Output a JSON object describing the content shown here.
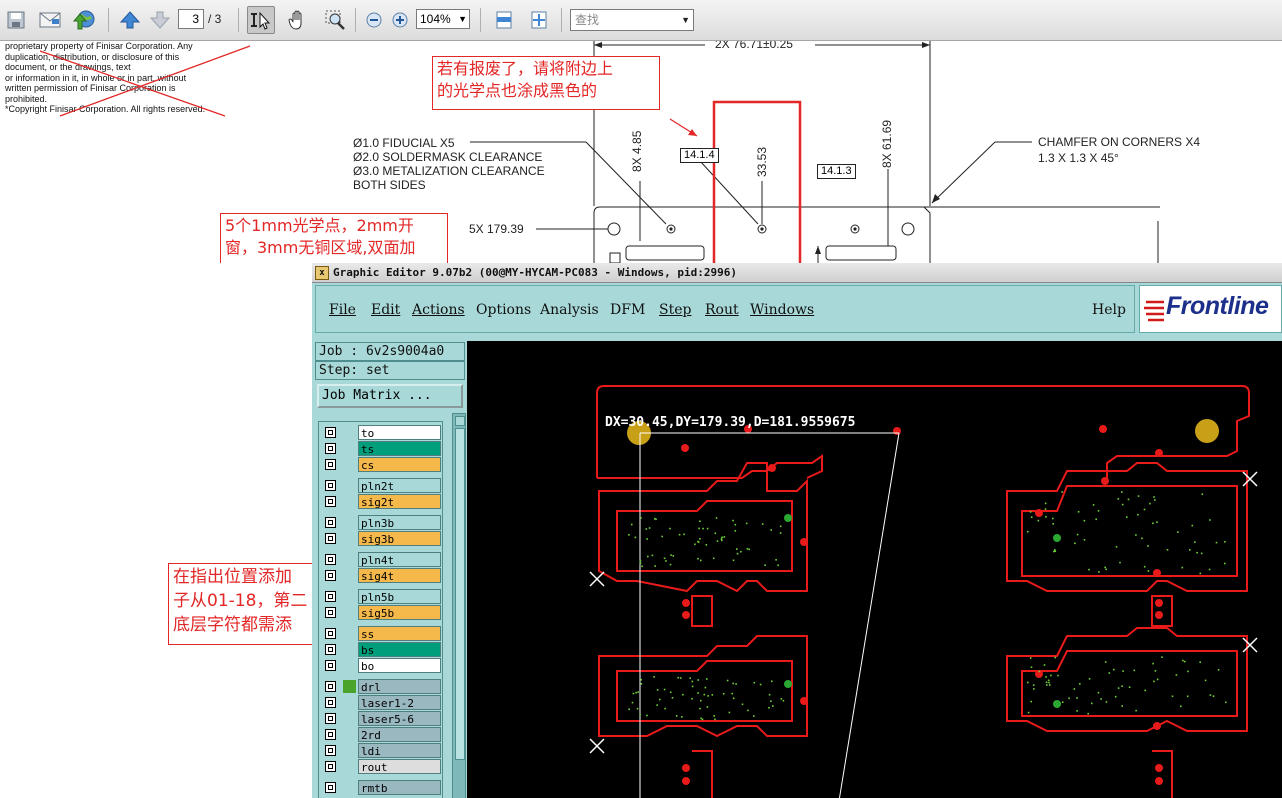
{
  "toolbar": {
    "page_current": "3",
    "page_total": "/ 3",
    "zoom": "104%",
    "search_placeholder": "查找"
  },
  "doc": {
    "legal_lines": [
      "proprietary property of Finisar Corporation. Any",
      "duplication, distribution, or disclosure of this",
      "document, or the drawings, text",
      "or information in it, in whole or in part, without",
      "written permission of Finisar Corporation is",
      "prohibited.",
      "*Copyright Finisar Corporation. All rights reserved."
    ],
    "dim_top": "2X 76.71±0.25",
    "fiducial_notes": [
      "Ø1.0 FIDUCIAL X5",
      "Ø2.0 SOLDERMASK CLEARANCE",
      "Ø3.0 METALIZATION CLEARANCE",
      "BOTH SIDES"
    ],
    "dim_fid_count": "5X 179.39",
    "dim_vert_a": "8X 4.85",
    "dim_vert_b": "33.53",
    "dim_vert_c": "8X 61.69",
    "ref_a": "14.1.4",
    "ref_b": "14.1.3",
    "chamfer_notes": [
      "CHAMFER ON CORNERS X4",
      "1.3 X 1.3 X 45°"
    ],
    "annotation_1": [
      "若有报废了，请将附边上",
      "的光学点也涂成黑色的"
    ],
    "annotation_2": [
      "5个1mm光学点，2mm开",
      "窗，3mm无铜区域,双面加"
    ],
    "annotation_3": [
      "在指出位置添加",
      "子从01-18，第二",
      "底层字符都需添"
    ]
  },
  "ge": {
    "title": "Graphic Editor 9.07b2 (00@MY-HYCAM-PC083 - Windows, pid:2996)",
    "menu": [
      {
        "label": "File",
        "underline": true
      },
      {
        "label": "Edit",
        "underline": true
      },
      {
        "label": "Actions",
        "underline": true
      },
      {
        "label": "Options",
        "underline": false
      },
      {
        "label": "Analysis",
        "underline": false
      },
      {
        "label": "DFM",
        "underline": false
      },
      {
        "label": "Step",
        "underline": true
      },
      {
        "label": "Rout",
        "underline": true
      },
      {
        "label": "Windows",
        "underline": true
      }
    ],
    "help": "Help",
    "logo": "Frontline",
    "job": "Job : 6v2s9004a0",
    "step": "Step: set",
    "job_matrix": "Job Matrix ...",
    "layers": [
      {
        "name": "to",
        "color": "#ffffff"
      },
      {
        "name": "ts",
        "color": "#009e7a"
      },
      {
        "name": "cs",
        "color": "#f5b84a"
      },
      {
        "name": "pln2t",
        "color": "#a8d8d8"
      },
      {
        "name": "sig2t",
        "color": "#f5b84a"
      },
      {
        "name": "pln3b",
        "color": "#a8d8d8"
      },
      {
        "name": "sig3b",
        "color": "#f5b84a"
      },
      {
        "name": "pln4t",
        "color": "#a8d8d8"
      },
      {
        "name": "sig4t",
        "color": "#f5b84a"
      },
      {
        "name": "pln5b",
        "color": "#a8d8d8"
      },
      {
        "name": "sig5b",
        "color": "#f5b84a"
      },
      {
        "name": "ss",
        "color": "#f5b84a"
      },
      {
        "name": "bs",
        "color": "#009e7a"
      },
      {
        "name": "bo",
        "color": "#ffffff"
      },
      {
        "name": "drl",
        "color": "#9ab8c0"
      },
      {
        "name": "laser1-2",
        "color": "#9ab8c0"
      },
      {
        "name": "laser5-6",
        "color": "#9ab8c0"
      },
      {
        "name": "2rd",
        "color": "#9ab8c0"
      },
      {
        "name": "ldi",
        "color": "#9ab8c0"
      },
      {
        "name": "rout",
        "color": "#dddddd"
      },
      {
        "name": "rmtb",
        "color": "#9ab8c0"
      }
    ],
    "measure": "DX=30.45,DY=179.39,D=181.9559675"
  }
}
